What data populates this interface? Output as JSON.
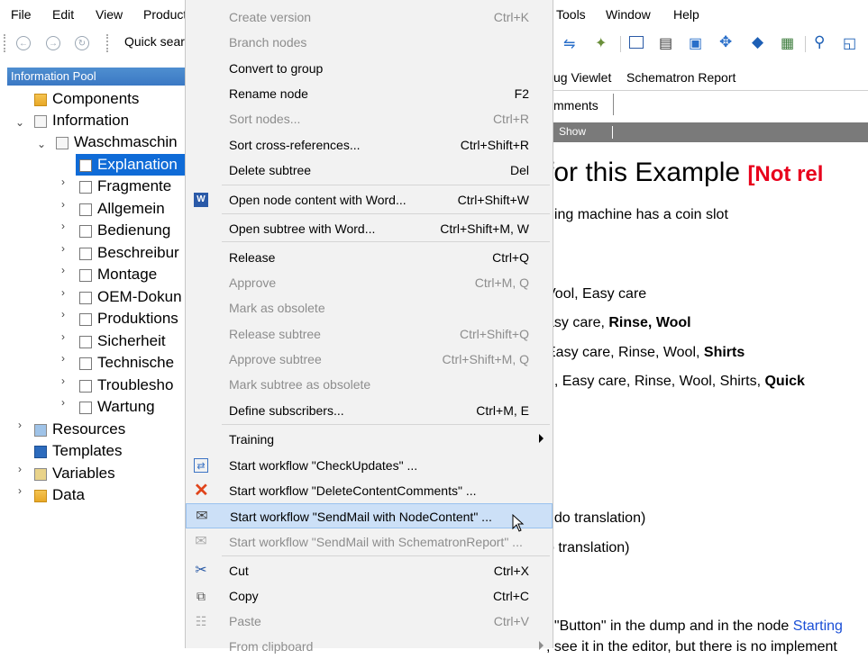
{
  "menubar": {
    "items": [
      "File",
      "Edit",
      "View",
      "Product",
      "Tools",
      "Window",
      "Help"
    ]
  },
  "toolbar": {
    "quick_search_label": "Quick sear"
  },
  "left_panel": {
    "header": "Information Pool",
    "tree": [
      {
        "label": "Components",
        "chevron": ""
      },
      {
        "label": "Information",
        "chevron": "v"
      },
      {
        "label": "Waschmaschin",
        "chevron": "v"
      },
      {
        "label": "Explanation",
        "chevron": ""
      },
      {
        "label": "Fragmente",
        "chevron": ">"
      },
      {
        "label": "Allgemein",
        "chevron": ">"
      },
      {
        "label": "Bedienung",
        "chevron": ">"
      },
      {
        "label": "Beschreibur",
        "chevron": ">"
      },
      {
        "label": "Montage",
        "chevron": ">"
      },
      {
        "label": "OEM-Dokun",
        "chevron": ">"
      },
      {
        "label": "Produktions",
        "chevron": ">"
      },
      {
        "label": "Sicherheit",
        "chevron": ">"
      },
      {
        "label": "Technische",
        "chevron": ">"
      },
      {
        "label": "Troublesho",
        "chevron": ">"
      },
      {
        "label": "Wartung",
        "chevron": ">"
      },
      {
        "label": "Resources",
        "chevron": ">"
      },
      {
        "label": "Templates",
        "chevron": ""
      },
      {
        "label": "Variables",
        "chevron": ">"
      },
      {
        "label": "Data",
        "chevron": ">"
      }
    ]
  },
  "right_area": {
    "tab1": "ug Viewlet",
    "tab2": "Schematron Report",
    "subtab": "mments",
    "show_label": "Show",
    "heading": "for this Example",
    "heading_tag": "[Not rel",
    "line1": "hing machine has a coin slot",
    "line2": "Vool, Easy care",
    "line3_a": "asy care, ",
    "line3_b": "Rinse, Wool",
    "line4_a": " Easy care, Rinse, Wool, ",
    "line4_b": "Shirts",
    "line5_a": "n, Easy care, Rinse, Wool, Shirts, ",
    "line5_b": "Quick",
    "line6": "udo translation)",
    "line7": "o translation)",
    "line8_a": "t \"Button\" in the dump and in the node ",
    "line8_b": "Starting",
    "line9": ", see it in the editor, but there is no implement"
  },
  "context_menu": {
    "items": [
      {
        "label": "Create version",
        "shortcut": "Ctrl+K",
        "disabled": true
      },
      {
        "label": "Branch nodes",
        "shortcut": "",
        "disabled": true
      },
      {
        "label": "Convert to group",
        "shortcut": "",
        "disabled": false
      },
      {
        "label": "Rename node",
        "shortcut": "F2",
        "disabled": false
      },
      {
        "label": "Sort nodes...",
        "shortcut": "Ctrl+R",
        "disabled": true
      },
      {
        "label": "Sort cross-references...",
        "shortcut": "Ctrl+Shift+R",
        "disabled": false
      },
      {
        "label": "Delete subtree",
        "shortcut": "Del",
        "disabled": false
      },
      {
        "label": "Open node content with Word...",
        "shortcut": "Ctrl+Shift+W",
        "disabled": false
      },
      {
        "label": "Open subtree with Word...",
        "shortcut": "Ctrl+Shift+M, W",
        "disabled": false
      },
      {
        "label": "Release",
        "shortcut": "Ctrl+Q",
        "disabled": false
      },
      {
        "label": "Approve",
        "shortcut": "Ctrl+M, Q",
        "disabled": true
      },
      {
        "label": "Mark as obsolete",
        "shortcut": "",
        "disabled": true
      },
      {
        "label": "Release subtree",
        "shortcut": "Ctrl+Shift+Q",
        "disabled": true
      },
      {
        "label": "Approve subtree",
        "shortcut": "Ctrl+Shift+M, Q",
        "disabled": true
      },
      {
        "label": "Mark subtree as obsolete",
        "shortcut": "",
        "disabled": true
      },
      {
        "label": "Define subscribers...",
        "shortcut": "Ctrl+M, E",
        "disabled": false
      },
      {
        "label": "Training",
        "shortcut": "",
        "disabled": false
      },
      {
        "label": "Start workflow \"CheckUpdates\" ...",
        "shortcut": "",
        "disabled": false
      },
      {
        "label": "Start workflow \"DeleteContentComments\" ...",
        "shortcut": "",
        "disabled": false
      },
      {
        "label": "Start workflow \"SendMail with NodeContent\" ...",
        "shortcut": "",
        "disabled": false
      },
      {
        "label": "Start workflow \"SendMail with SchematronReport\" ...",
        "shortcut": "",
        "disabled": true
      },
      {
        "label": "Cut",
        "shortcut": "Ctrl+X",
        "disabled": false
      },
      {
        "label": "Copy",
        "shortcut": "Ctrl+C",
        "disabled": false
      },
      {
        "label": "Paste",
        "shortcut": "Ctrl+V",
        "disabled": true
      },
      {
        "label": "From clipboard",
        "shortcut": "",
        "disabled": true
      }
    ]
  },
  "colors": {
    "selection": "#0f6bd7",
    "menu_highlight": "#cce0f7",
    "not_released_red": "#e8001c",
    "link_blue": "#1a4fd6"
  }
}
